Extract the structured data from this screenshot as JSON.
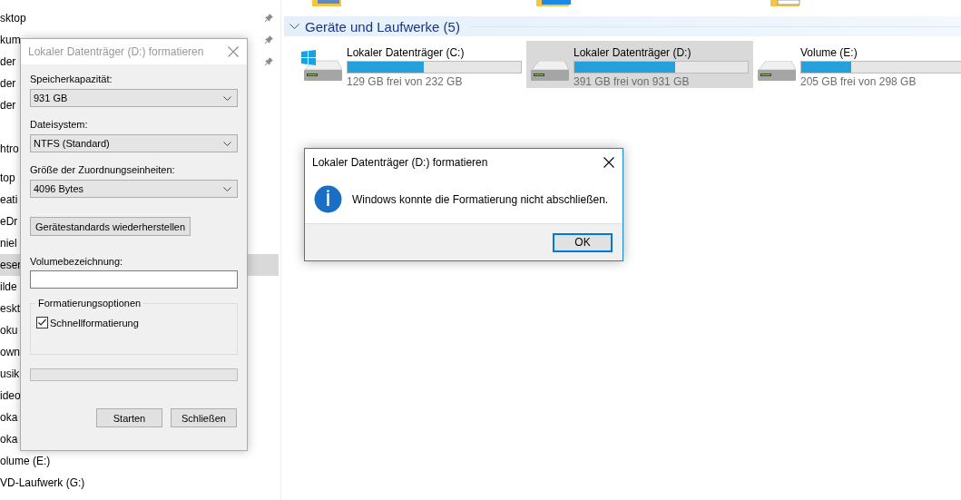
{
  "navigation": {
    "sections": [
      {
        "items": [
          {
            "label": "sktop",
            "pinned": true,
            "selected": false
          },
          {
            "label": "kum",
            "pinned": true,
            "selected": false
          },
          {
            "label": "der",
            "pinned": true,
            "selected": false
          },
          {
            "label": "der",
            "pinned": false,
            "selected": false
          },
          {
            "label": "der",
            "pinned": false,
            "selected": false
          }
        ]
      },
      {
        "items": [
          {
            "label": "htro",
            "pinned": false,
            "selected": false
          }
        ]
      },
      {
        "items": [
          {
            "label": "top",
            "pinned": false,
            "selected": false
          },
          {
            "label": "eati",
            "pinned": false,
            "selected": false
          },
          {
            "label": "eDr",
            "pinned": false,
            "selected": false
          },
          {
            "label": "niel",
            "pinned": false,
            "selected": false
          },
          {
            "label": "eser",
            "pinned": false,
            "selected": true
          },
          {
            "label": "ilde",
            "pinned": false,
            "selected": false
          },
          {
            "label": "eskt",
            "pinned": false,
            "selected": false
          },
          {
            "label": "oku",
            "pinned": false,
            "selected": false
          },
          {
            "label": "own",
            "pinned": false,
            "selected": false
          },
          {
            "label": "usik",
            "pinned": false,
            "selected": false
          },
          {
            "label": "ideo",
            "pinned": false,
            "selected": false
          },
          {
            "label": "oka",
            "pinned": false,
            "selected": false
          },
          {
            "label": "oka",
            "pinned": false,
            "selected": false
          },
          {
            "label": "olume (E:)",
            "pinned": false,
            "selected": false
          },
          {
            "label": "VD-Laufwerk (G:)",
            "pinned": false,
            "selected": false
          }
        ]
      }
    ]
  },
  "devices": {
    "heading": "Geräte und Laufwerke (5)",
    "expanded": true,
    "drives": [
      {
        "kind": "windows",
        "name": "Lokaler Datenträger (C:)",
        "level": 0.44,
        "free": "129 GB frei von 232 GB",
        "selected": false
      },
      {
        "kind": "disk",
        "name": "Lokaler Datenträger (D:)",
        "level": 0.58,
        "free": "391 GB frei von 931 GB",
        "selected": true
      },
      {
        "kind": "disk",
        "name": "Volume (E:)",
        "level": 0.31,
        "free": "205 GB frei von 298 GB",
        "selected": false
      }
    ]
  },
  "format_dialog": {
    "title": "Lokaler Datenträger (D:) formatieren",
    "active": false,
    "fields": [
      {
        "label": "Speicherkapazität:",
        "value": "931 GB"
      },
      {
        "label": "Dateisystem:",
        "value": "NTFS (Standard)"
      },
      {
        "label": "Größe der Zuordnungseinheiten:",
        "value": "4096 Bytes"
      }
    ],
    "restore_button": "Gerätestandards wiederherstellen",
    "volume_label": {
      "label": "Volumebezeichnung:"
    },
    "options": {
      "legend": "Formatierungsoptionen",
      "quick_format": {
        "label": "Schnellformatierung",
        "checked": true
      }
    },
    "progress": {
      "level": 0
    },
    "buttons": [
      "Starten",
      "Schließen"
    ]
  },
  "message_box": {
    "title": "Lokaler Datenträger (D:) formatieren",
    "message": "Windows konnte die Formatierung nicht abschließen.",
    "button": "OK"
  }
}
